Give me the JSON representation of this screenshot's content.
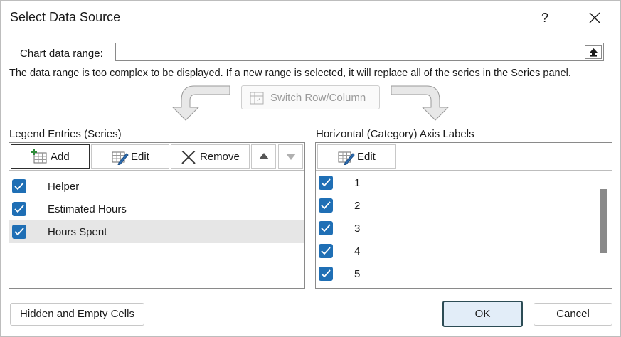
{
  "dialog": {
    "title": "Select Data Source",
    "help_label": "?",
    "close_icon": "close-icon"
  },
  "range": {
    "label": "Chart data range:",
    "value": "",
    "collapse_icon": "collapse-dialog-icon"
  },
  "warning": "The data range is too complex to be displayed. If a new range is selected, it will replace all of the series in the Series panel.",
  "switch_button": {
    "label": "Switch Row/Column",
    "enabled": false
  },
  "legend": {
    "label": "Legend Entries (Series)",
    "toolbar": {
      "add": "Add",
      "edit": "Edit",
      "remove": "Remove",
      "up_icon": "arrow-up-icon",
      "down_icon": "arrow-down-icon"
    },
    "items": [
      {
        "label": "Helper",
        "checked": true,
        "selected": false
      },
      {
        "label": "Estimated Hours",
        "checked": true,
        "selected": false
      },
      {
        "label": "Hours Spent",
        "checked": true,
        "selected": true
      }
    ]
  },
  "axis": {
    "label": "Horizontal (Category) Axis Labels",
    "toolbar": {
      "edit": "Edit"
    },
    "items": [
      {
        "label": "1",
        "checked": true
      },
      {
        "label": "2",
        "checked": true
      },
      {
        "label": "3",
        "checked": true
      },
      {
        "label": "4",
        "checked": true
      },
      {
        "label": "5",
        "checked": true
      }
    ]
  },
  "footer": {
    "hidden_cells": "Hidden and Empty Cells",
    "ok": "OK",
    "cancel": "Cancel"
  },
  "colors": {
    "checkbox": "#1f6fb5",
    "ok_bg": "#e2edf8",
    "ok_border": "#2c4c55",
    "selected_row": "#e6e6e6"
  }
}
